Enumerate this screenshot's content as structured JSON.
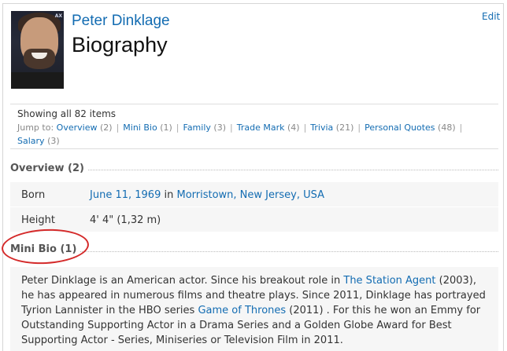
{
  "header": {
    "name": "Peter Dinklage",
    "title": "Biography",
    "edit": "Edit",
    "photo_alt": "Peter Dinklage photo",
    "photo_corner_text": "AX"
  },
  "jump": {
    "showing": "Showing all 82 items",
    "label": "Jump to:",
    "items": [
      {
        "label": "Overview",
        "count": "(2)"
      },
      {
        "label": "Mini Bio",
        "count": "(1)"
      },
      {
        "label": "Family",
        "count": "(3)"
      },
      {
        "label": "Trade Mark",
        "count": "(4)"
      },
      {
        "label": "Trivia",
        "count": "(21)"
      },
      {
        "label": "Personal Quotes",
        "count": "(48)"
      },
      {
        "label": "Salary",
        "count": "(3)"
      }
    ]
  },
  "overview": {
    "heading": "Overview (2)",
    "born_label": "Born",
    "born_date": "June 11, 1969",
    "born_in": "in",
    "born_place": "Morristown, New Jersey, USA",
    "height_label": "Height",
    "height_value": "4' 4\" (1,32 m)"
  },
  "minibio": {
    "heading": "Mini Bio (1)",
    "p1": "Peter Dinklage is an American actor. Since his breakout role in ",
    "link1": "The Station Agent",
    "p2": " (2003), he has appeared in numerous films and theatre plays. Since 2011, Dinklage has portrayed Tyrion Lannister in the HBO series ",
    "link2": "Game of Thrones",
    "p3": " (2011) . For this he won an Emmy for Outstanding Supporting Actor in a Drama Series and a Golden Globe Award for Best Supporting Actor - Series, Miniseries or Television Film in 2011."
  },
  "colors": {
    "link": "#136cb2",
    "annotation_circle": "#d42a2a",
    "row_background": "#f6f6f6"
  }
}
